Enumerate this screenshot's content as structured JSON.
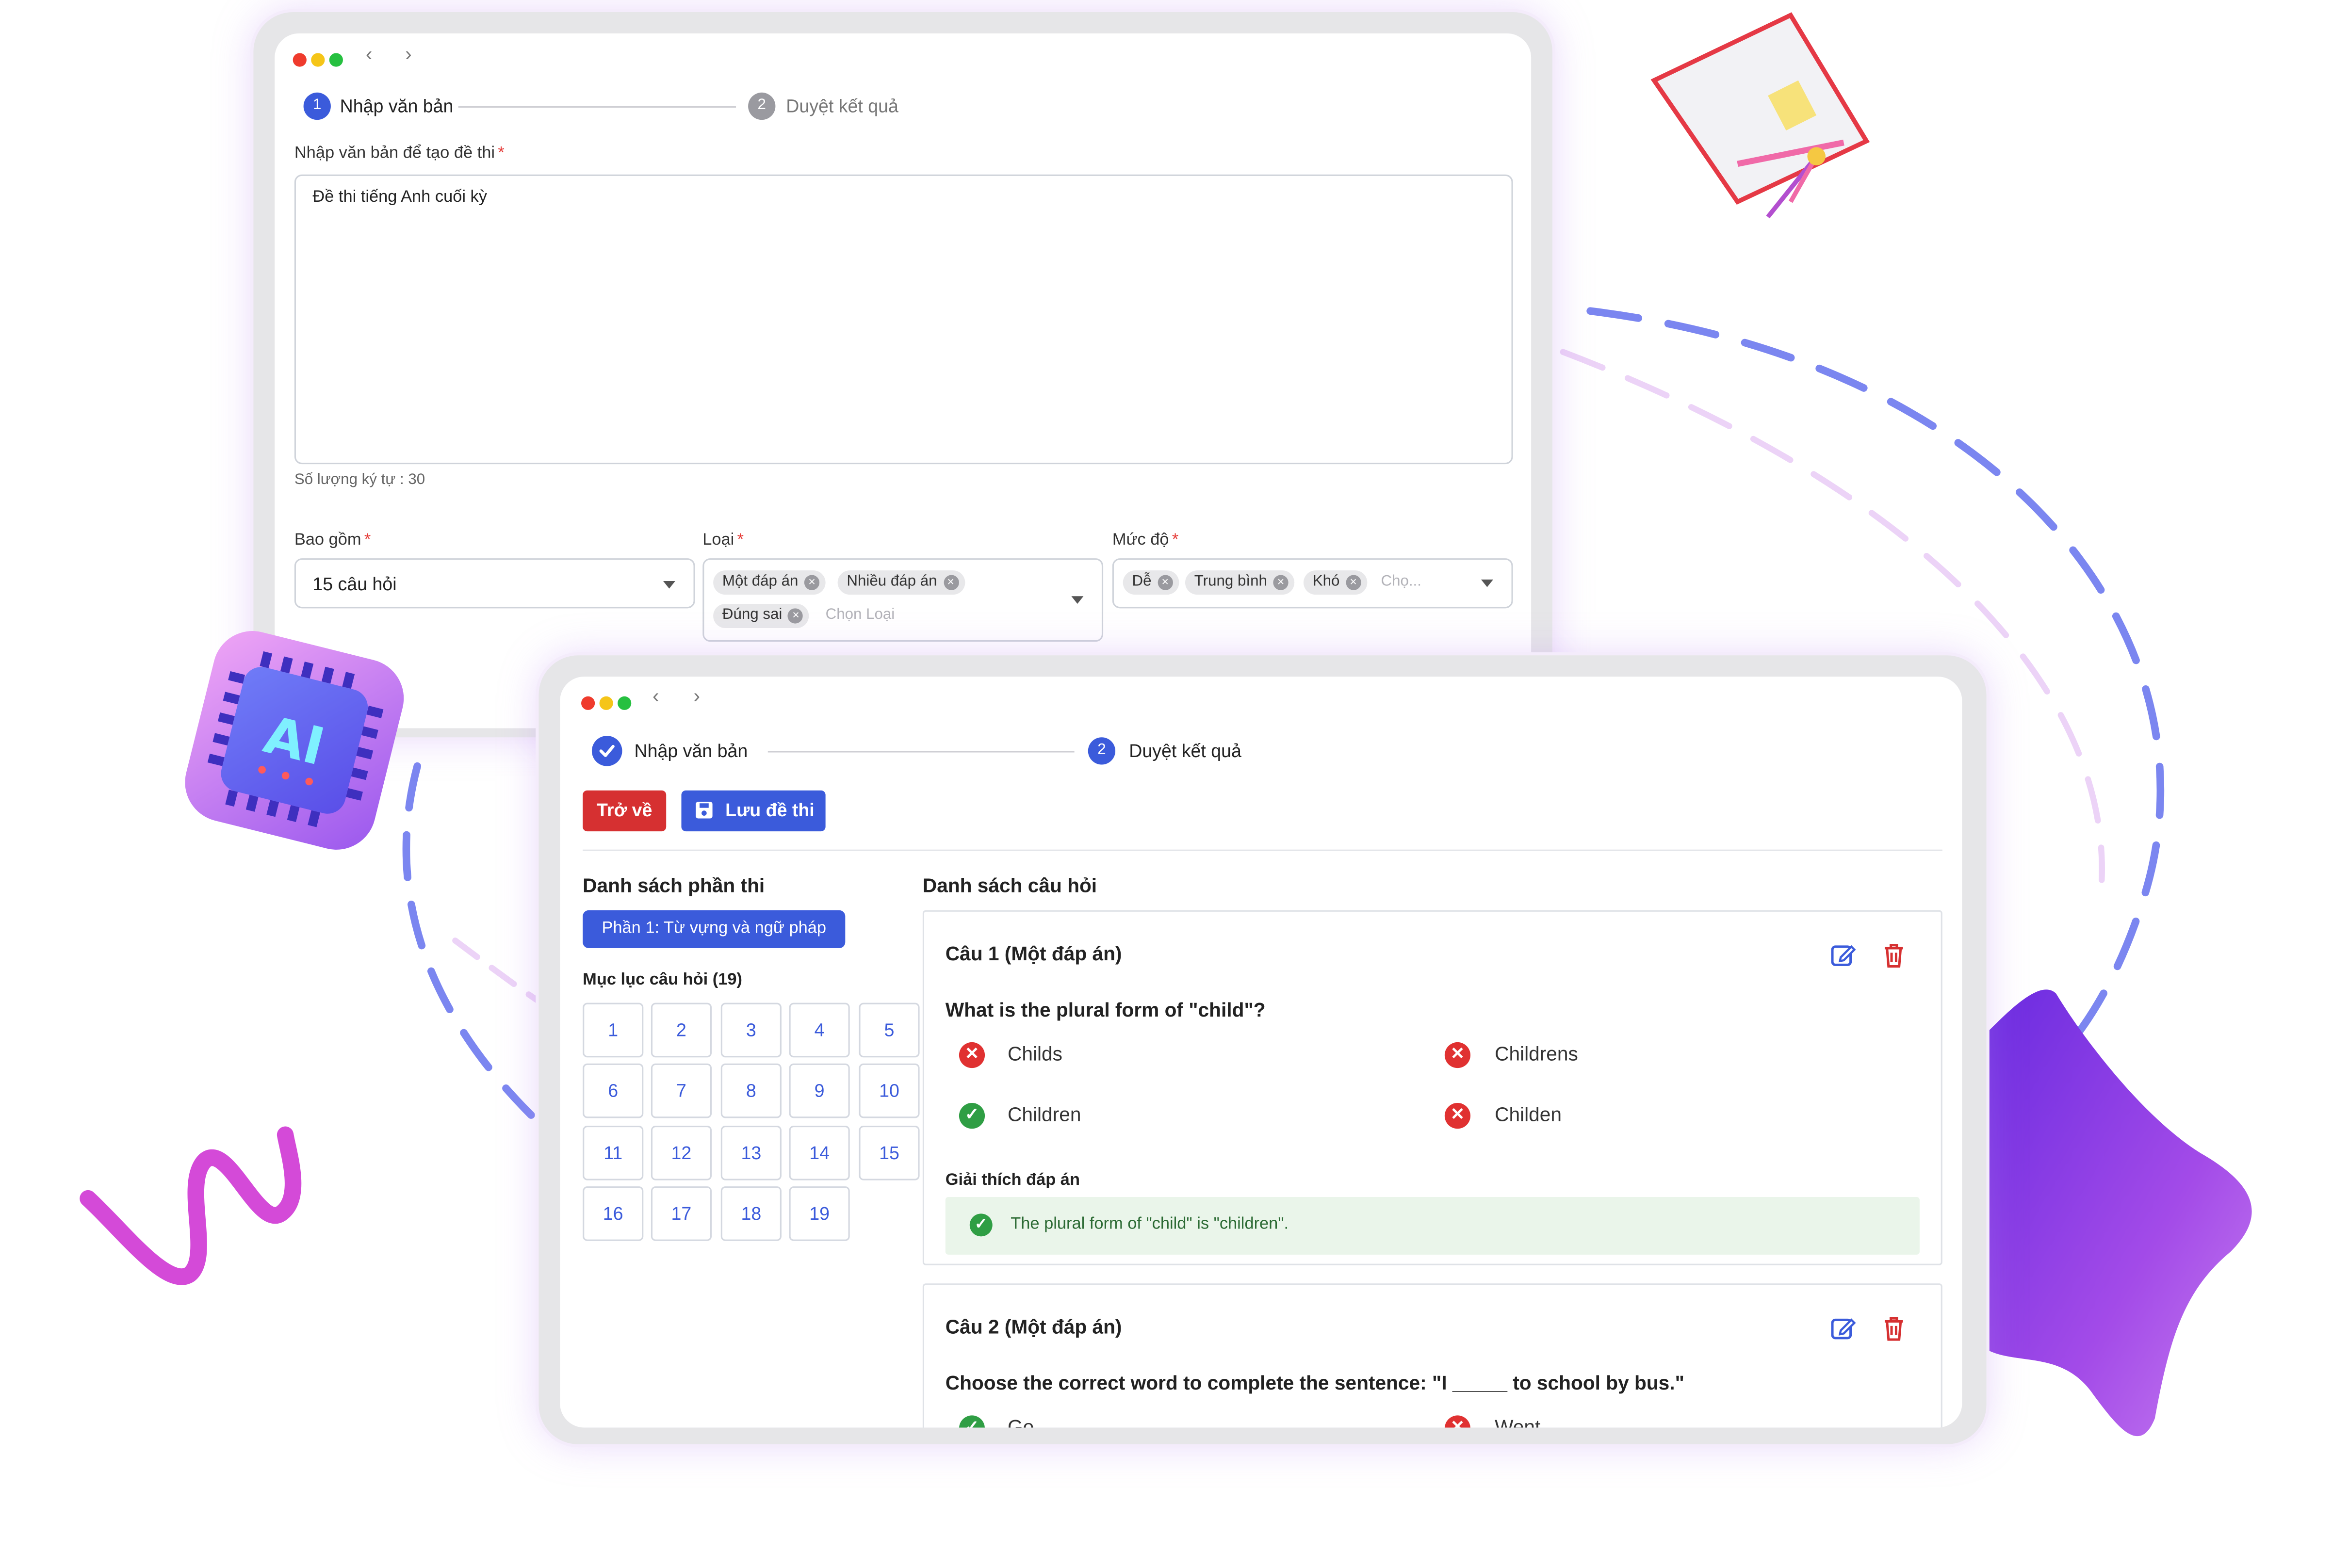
{
  "back_window": {
    "steps": [
      {
        "number": "1",
        "label": "Nhập văn bản"
      },
      {
        "number": "2",
        "label": "Duyệt kết quả"
      }
    ],
    "text_label": "Nhập văn bản để tạo đề thi",
    "text_value": "Đề thi tiếng Anh cuối kỳ",
    "char_count": "Số lượng ký tự : 30",
    "include_label": "Bao gồm",
    "include_value": "15 câu hỏi",
    "type_label": "Loại",
    "type_chips": [
      "Một đáp án",
      "Nhiều đáp án",
      "Đúng sai"
    ],
    "type_placeholder": "Chọn Loại",
    "level_label": "Mức độ",
    "level_chips": [
      "Dễ",
      "Trung bình",
      "Khó"
    ],
    "level_placeholder": "Chọ..."
  },
  "front_window": {
    "steps": [
      {
        "number": "",
        "label": "Nhập văn bản"
      },
      {
        "number": "2",
        "label": "Duyệt kết quả"
      }
    ],
    "back_button": "Trở về",
    "save_button": "Lưu đề thi",
    "sections_title": "Danh sách phần thi",
    "section_button": "Phần 1: Từ vựng và ngữ pháp",
    "index_title": "Mục lục câu hỏi (19)",
    "question_numbers": [
      "1",
      "2",
      "3",
      "4",
      "5",
      "6",
      "7",
      "8",
      "9",
      "10",
      "11",
      "12",
      "13",
      "14",
      "15",
      "16",
      "17",
      "18",
      "19"
    ],
    "questions_title": "Danh sách câu hỏi",
    "questions": [
      {
        "title": "Câu 1 (Một đáp án)",
        "text": "What is the plural form of \"child\"?",
        "answers": [
          {
            "text": "Childs",
            "correct": false
          },
          {
            "text": "Childrens",
            "correct": false
          },
          {
            "text": "Children",
            "correct": true
          },
          {
            "text": "Childen",
            "correct": false
          }
        ],
        "explanation_label": "Giải thích đáp án",
        "explanation": "The plural form of \"child\" is \"children\"."
      },
      {
        "title": "Câu 2 (Một đáp án)",
        "text": "Choose the correct word to complete the sentence: \"I _____ to school by bus.\"",
        "answers": [
          {
            "text": "Go",
            "correct": true
          },
          {
            "text": "Went",
            "correct": false
          }
        ]
      }
    ]
  },
  "decorations": {
    "ai_chip_text": "AI"
  },
  "colors": {
    "primary": "#3b5bdb",
    "danger": "#d63031",
    "success": "#2f9e44",
    "explanation_bg": "#eaf5ea"
  }
}
